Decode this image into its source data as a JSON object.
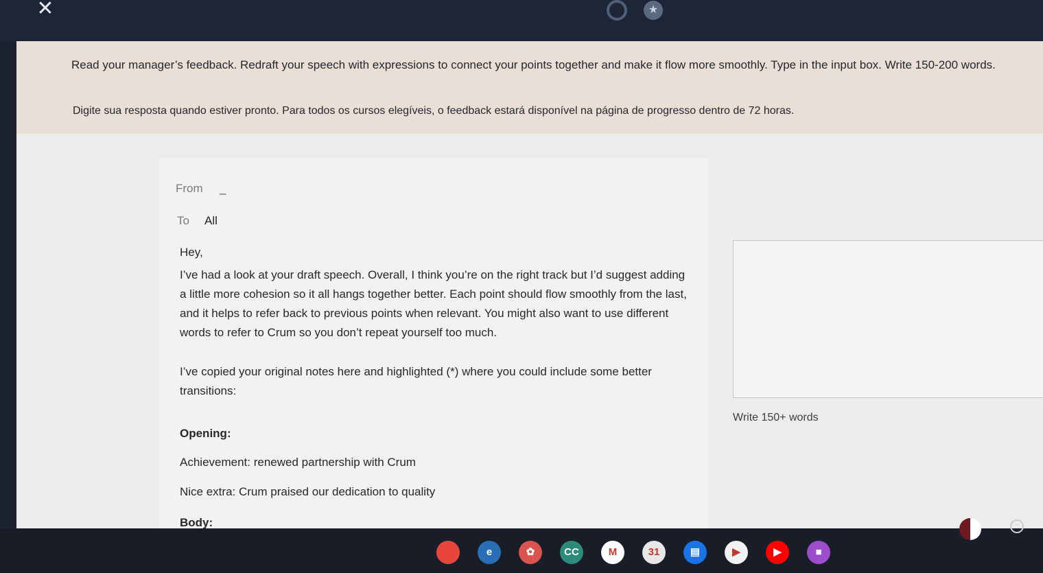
{
  "window": {
    "close_glyph": "✕",
    "star_glyph": "★"
  },
  "instructions": {
    "line1": "Read your manager’s feedback. Redraft your speech with expressions to connect your points together and make it flow more smoothly. Type in the input box. Write 150-200 words.",
    "line2": "Digite sua resposta quando estiver pronto. Para todos os cursos elegíveis, o feedback estará disponível na página de progresso dentro de 72 horas."
  },
  "email": {
    "from_label": "From",
    "from_value": "_",
    "to_label": "To",
    "to_value": "All",
    "greeting": "Hey,",
    "paragraph1": "I’ve had a look at your draft speech. Overall, I think you’re on the right track but I’d suggest adding a little more cohesion so it all hangs together better. Each point should flow smoothly from the last, and it helps to refer back to previous points when relevant. You might also want to use different words to refer to Crum so you don’t repeat yourself too much.",
    "paragraph2": "I’ve copied your original notes here and highlighted (*) where you could include some better transitions:",
    "opening_heading": "Opening:",
    "opening_item1": "Achievement: renewed partnership with Crum",
    "opening_item2": "Nice extra: Crum praised our dedication to quality",
    "body_heading": "Body:"
  },
  "answer": {
    "value": "",
    "word_hint": "Write 150+ words"
  },
  "shelf": {
    "apps": [
      {
        "name": "chrome-icon",
        "glyph": "",
        "color": "#e8453c"
      },
      {
        "name": "edge-icon",
        "glyph": "e",
        "color": "#2a6fb5"
      },
      {
        "name": "app-red-icon",
        "glyph": "✿",
        "color": "#d9534f"
      },
      {
        "name": "app-cc-icon",
        "glyph": "CC",
        "color": "#2e8b7a"
      },
      {
        "name": "gmail-icon",
        "glyph": "M",
        "color": "#ffffff"
      },
      {
        "name": "calendar-icon",
        "glyph": "31",
        "color": "#e7e7e7"
      },
      {
        "name": "files-icon",
        "glyph": "▤",
        "color": "#1a73e8"
      },
      {
        "name": "play-store-icon",
        "glyph": "▶",
        "color": "#f2f2f2"
      },
      {
        "name": "youtube-icon",
        "glyph": "▶",
        "color": "#ff0000"
      },
      {
        "name": "app-purple-icon",
        "glyph": "■",
        "color": "#9c4dcc"
      }
    ]
  }
}
